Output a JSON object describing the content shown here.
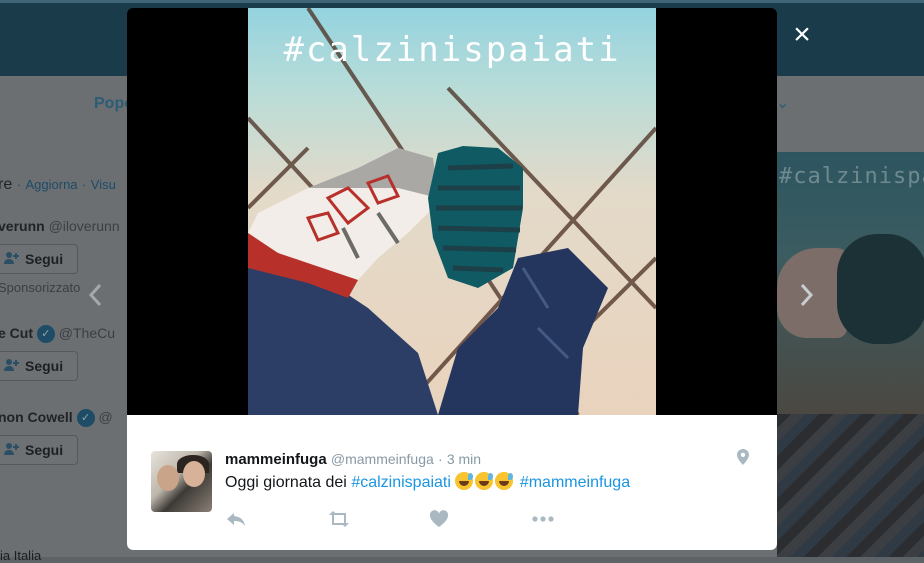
{
  "background": {
    "nav_label": "Popo",
    "who_to_follow": {
      "heading_fragment": "re",
      "refresh_link": "Aggiorna",
      "separator": "·",
      "view_all_fragment": "Visu"
    },
    "suggestions": [
      {
        "name": "verunn",
        "handle": "@iloverunn",
        "button_label": "Segui",
        "note": "Sponsorizzato"
      },
      {
        "name": "e Cut",
        "handle": "@TheCu",
        "button_label": "Segui"
      },
      {
        "name": "non Cowell",
        "handle": "@",
        "button_label": "Segui"
      }
    ],
    "thumb_hashtag": "#calzinispaiati",
    "footer_fragment": "ia Italia"
  },
  "modal": {
    "photo_overlay_text": "#calzinispaiati",
    "close_label": "×",
    "tweet": {
      "name": "mammeinfuga",
      "handle": "@mammeinfuga",
      "separator": "·",
      "time": "3 min",
      "text_prefix": "Oggi giornata dei ",
      "hashtag1": "#calzinispaiati",
      "hashtag2": "#mammeinfuga"
    },
    "actions": [
      "reply-icon",
      "retweet-icon",
      "like-icon",
      "more-icon"
    ]
  },
  "colors": {
    "link": "#1b95e0",
    "icon_gray": "#aab8c2",
    "overlay_bg": "#000000"
  }
}
